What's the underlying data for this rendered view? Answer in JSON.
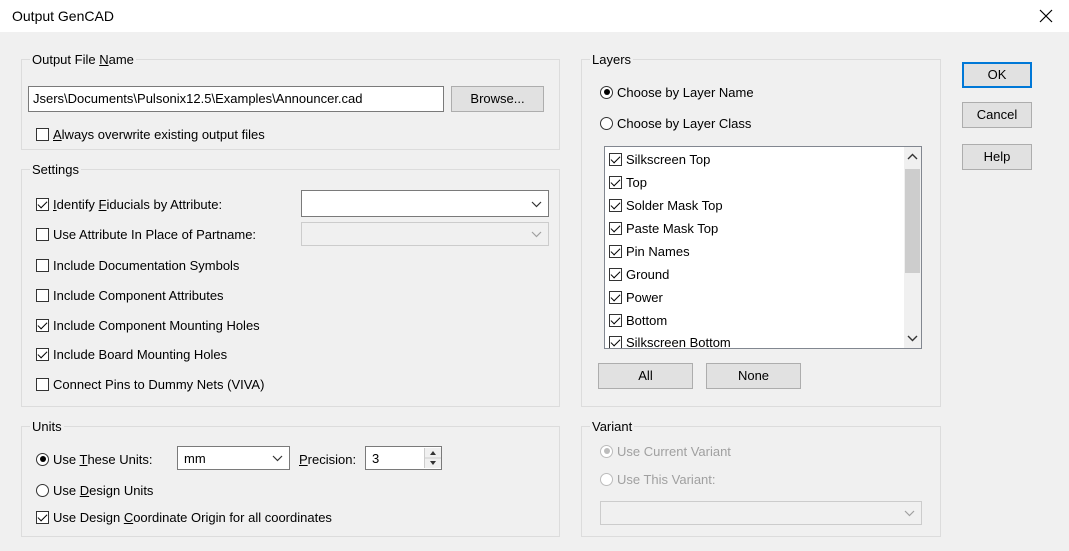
{
  "window": {
    "title": "Output GenCAD"
  },
  "output_file": {
    "group_label_pre": "Output File ",
    "group_label_u": "N",
    "group_label_post": "ame",
    "path": "Jsers\\Documents\\Pulsonix12.5\\Examples\\Announcer.cad",
    "browse_label": "Browse...",
    "always_overwrite_u": "A",
    "always_overwrite_rest": "lways overwrite existing output files",
    "always_overwrite_checked": false
  },
  "settings": {
    "group_label": "Settings",
    "identify_fiducials": {
      "u": "I",
      "rest1": "dentify ",
      "u2": "F",
      "rest2": "iducials by Attribute:",
      "checked": true,
      "value": ""
    },
    "use_attribute": {
      "label": "Use Attribute In Place of Partname:",
      "checked": false,
      "value": ""
    },
    "options": [
      {
        "label": "Include Documentation Symbols",
        "checked": false
      },
      {
        "label": "Include Component Attributes",
        "checked": false
      },
      {
        "label": "Include Component Mounting Holes",
        "checked": true
      },
      {
        "label": "Include Board Mounting Holes",
        "checked": true
      },
      {
        "label": "Connect Pins to Dummy Nets (VIVA)",
        "checked": false
      }
    ]
  },
  "units": {
    "group_label": "Units",
    "use_these_pre": "Use ",
    "use_these_u": "T",
    "use_these_post": "hese Units:",
    "use_these_selected": true,
    "units_value": "mm",
    "precision_u": "P",
    "precision_rest": "recision:",
    "precision_value": "3",
    "use_design_pre": "Use ",
    "use_design_u": "D",
    "use_design_post": "esign Units",
    "use_design_selected": false,
    "origin_pre": "Use Design ",
    "origin_u": "C",
    "origin_post": "oordinate Origin for all coordinates",
    "origin_checked": true
  },
  "layers": {
    "group_label": "Layers",
    "by_name": {
      "label": "Choose by Layer Name",
      "selected": true
    },
    "by_class": {
      "label": "Choose by Layer Class",
      "selected": false
    },
    "items": [
      {
        "label": "Silkscreen Top",
        "checked": true
      },
      {
        "label": "Top",
        "checked": true
      },
      {
        "label": "Solder Mask Top",
        "checked": true
      },
      {
        "label": "Paste Mask Top",
        "checked": true
      },
      {
        "label": "Pin Names",
        "checked": true
      },
      {
        "label": "Ground",
        "checked": true
      },
      {
        "label": "Power",
        "checked": true
      },
      {
        "label": "Bottom",
        "checked": true
      },
      {
        "label": "Silkscreen Bottom",
        "checked": true
      }
    ],
    "all_label": "All",
    "none_label": "None"
  },
  "variant": {
    "group_label": "Variant",
    "current": {
      "label": "Use Current Variant",
      "selected": true
    },
    "this": {
      "label": "Use This Variant:",
      "selected": false
    },
    "value": ""
  },
  "buttons": {
    "ok": "OK",
    "cancel": "Cancel",
    "help": "Help"
  },
  "icons": {
    "close": "close-icon",
    "dropdown": "chevron-down-icon",
    "scroll_up": "chevron-up-icon",
    "scroll_down": "chevron-down-icon",
    "spin": "spin-arrows-icon"
  }
}
